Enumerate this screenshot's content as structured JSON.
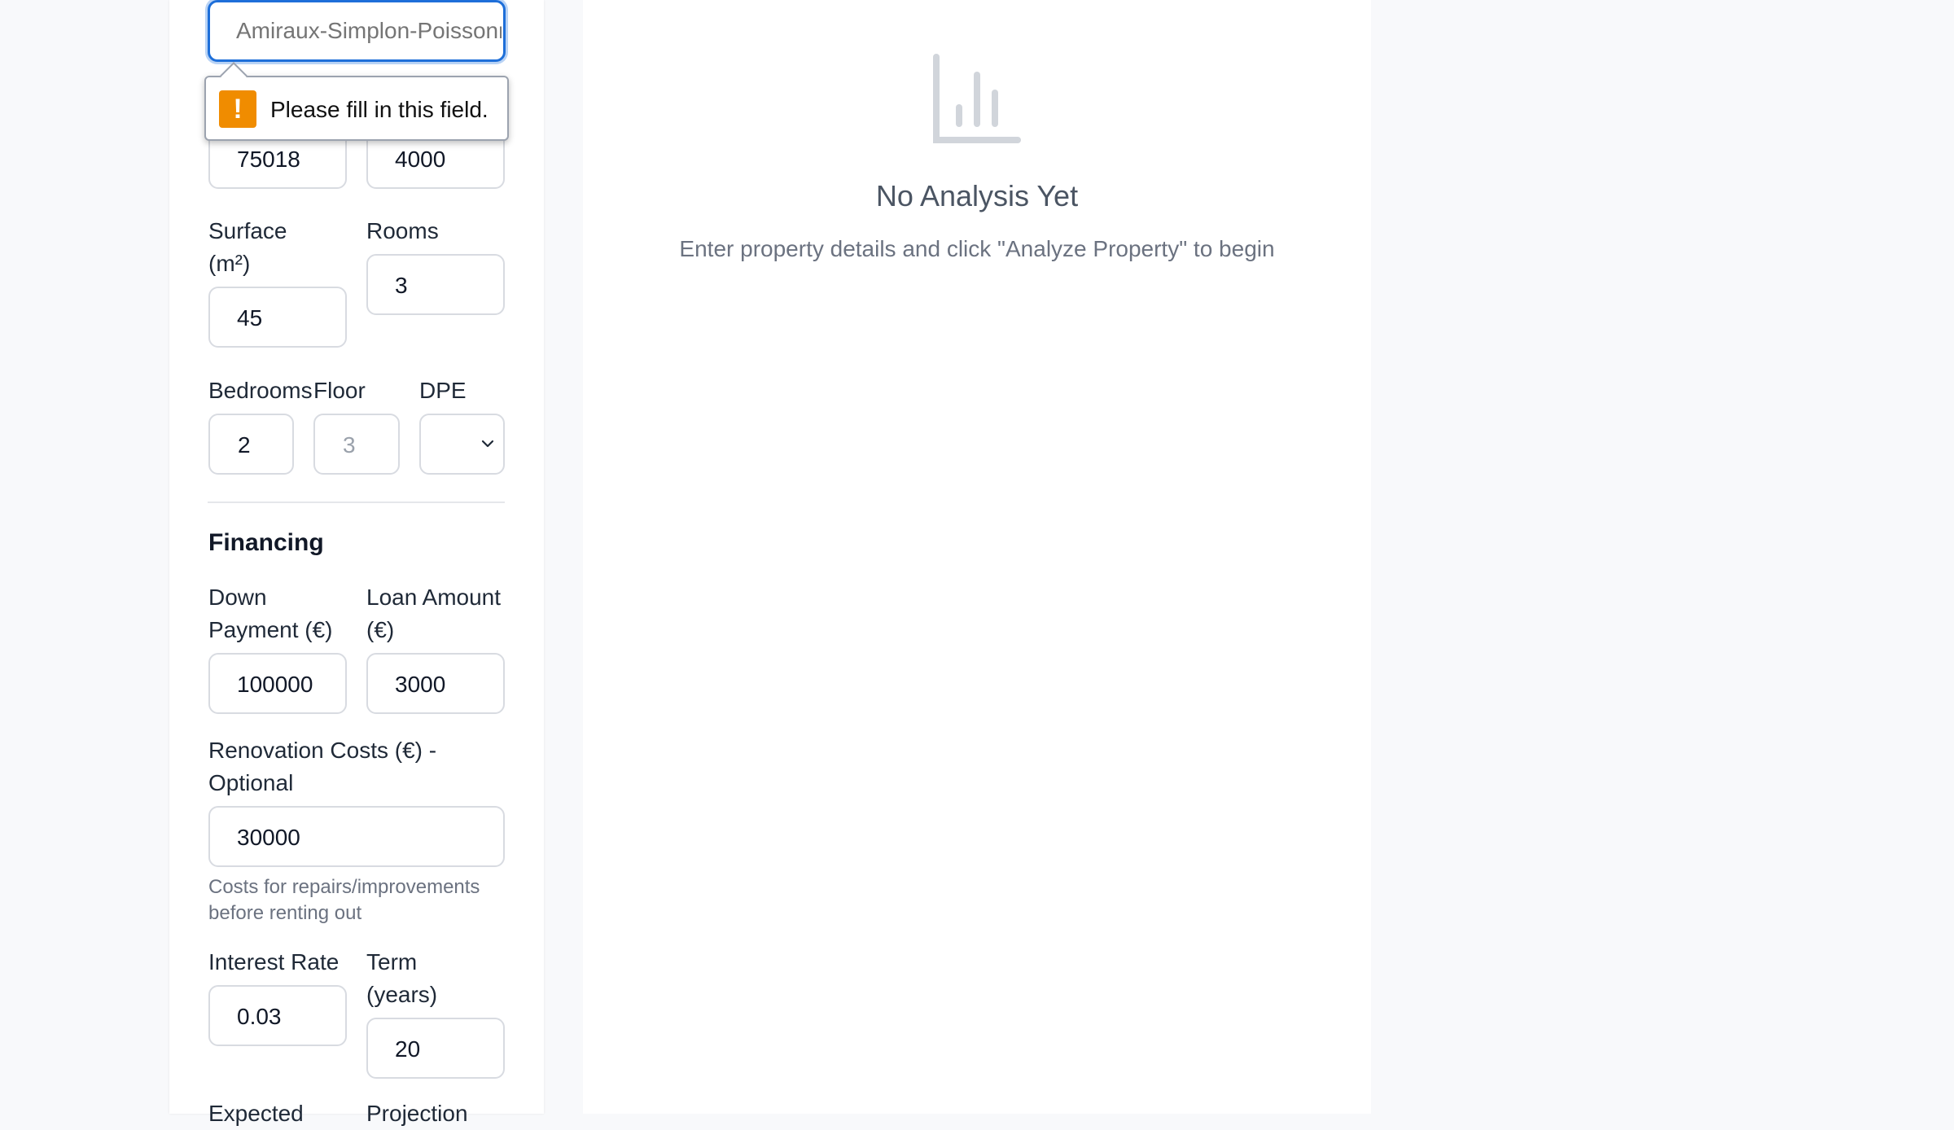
{
  "form": {
    "address_placeholder": "Amiraux-Simplon-Poissonniers",
    "validation_message": "Please fill in this field.",
    "postal_code_value": "75018",
    "price_m2_value": "4000",
    "surface_label": "Surface (m²)",
    "surface_value": "45",
    "rooms_label": "Rooms",
    "rooms_value": "3",
    "bedrooms_label": "Bedrooms",
    "bedrooms_value": "2",
    "floor_label": "Floor",
    "floor_placeholder": "3",
    "dpe_label": "DPE",
    "dpe_value": ""
  },
  "financing": {
    "section_title": "Financing",
    "down_payment_label": "Down Payment (€)",
    "down_payment_value": "100000",
    "loan_amount_label": "Loan Amount (€)",
    "loan_amount_value": "3000",
    "renovation_label": "Renovation Costs (€) - Optional",
    "renovation_value": "30000",
    "renovation_hint": "Costs for repairs/improvements before renting out",
    "interest_rate_label": "Interest Rate",
    "interest_rate_value": "0.03",
    "term_label": "Term (years)",
    "term_value": "20",
    "expected_label": "Expected",
    "projection_label": "Projection"
  },
  "results": {
    "icon": "bar-chart-icon",
    "empty_title": "No Analysis Yet",
    "empty_text": "Enter property details and click \"Analyze Property\" to begin"
  },
  "colors": {
    "focus_border": "#1e6fd9",
    "warning": "#f08c00",
    "page_background": "#f8f9fb"
  }
}
